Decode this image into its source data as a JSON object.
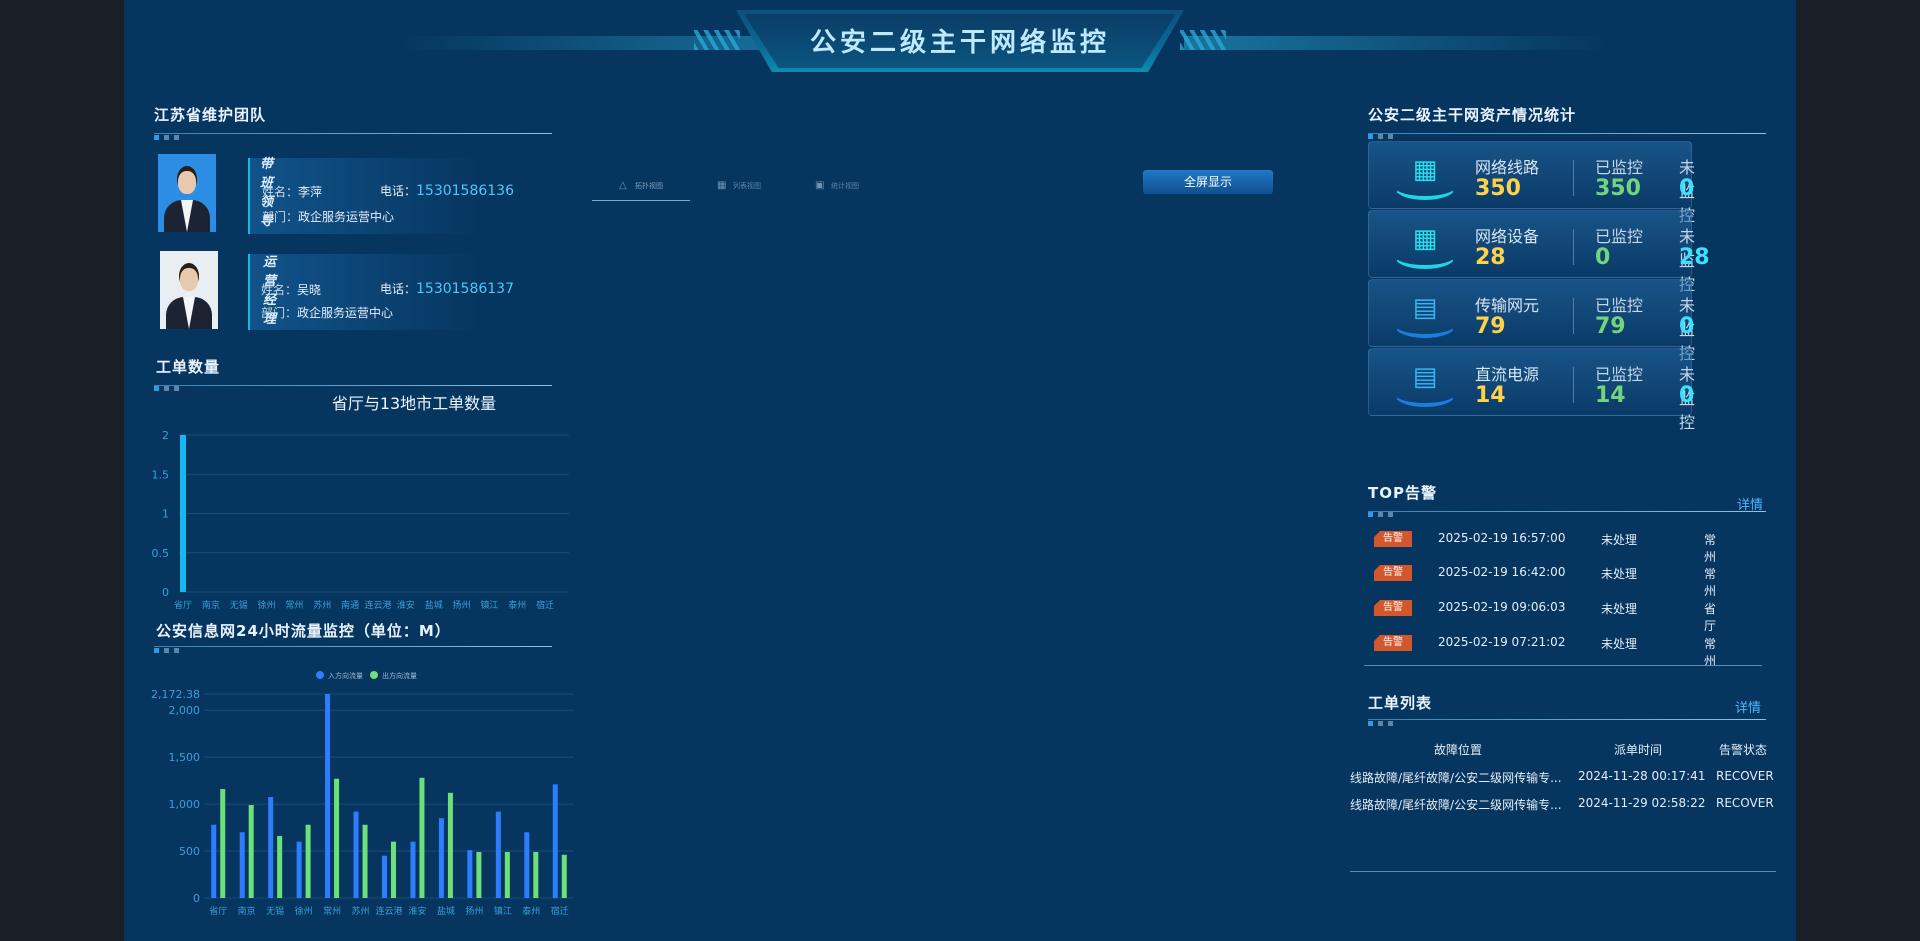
{
  "header": {
    "title": "公安二级主干网络监控"
  },
  "team": {
    "title": "江苏省维护团队",
    "members": [
      {
        "role": "带班领导",
        "name_label": "姓名：",
        "name": "李萍",
        "tel_label": "电话：",
        "tel": "15301586136",
        "dept_label": "部门：",
        "dept": "政企服务运营中心"
      },
      {
        "role": "运营经理",
        "name_label": "姓名：",
        "name": "吴晓",
        "tel_label": "电话：",
        "tel": "15301586137",
        "dept_label": "部门：",
        "dept": "政企服务运营中心"
      }
    ]
  },
  "work_orders_count": {
    "title": "工单数量",
    "chart_title": "省厅与13地市工单数量"
  },
  "traffic": {
    "title": "公安信息网24小时流量监控（单位：M）"
  },
  "center": {
    "tabs": [
      {
        "label": "拓扑视图",
        "icon": "topology-icon"
      },
      {
        "label": "列表视图",
        "icon": "grid-icon"
      },
      {
        "label": "统计视图",
        "icon": "chart-icon"
      }
    ],
    "button_label": "全屏显示"
  },
  "assets": {
    "title": "公安二级主干网资产情况统计",
    "monitored_label": "已监控",
    "unmonitored_label": "未监控",
    "rows": [
      {
        "name": "网络线路",
        "total": "350",
        "monitored": "350",
        "unmonitored": "0",
        "icon": "server-icon"
      },
      {
        "name": "网络设备",
        "total": "28",
        "monitored": "0",
        "unmonitored": "28",
        "icon": "server-icon"
      },
      {
        "name": "传输网元",
        "total": "79",
        "monitored": "79",
        "unmonitored": "0",
        "icon": "rack-icon"
      },
      {
        "name": "直流电源",
        "total": "14",
        "monitored": "14",
        "unmonitored": "0",
        "icon": "rack-icon"
      }
    ]
  },
  "alarms": {
    "title": "TOP告警",
    "detail": "详情",
    "rows": [
      {
        "tag": "告警",
        "time": "2025-02-19 16:57:00",
        "status": "未处理",
        "city": "常州"
      },
      {
        "tag": "告警",
        "time": "2025-02-19 16:42:00",
        "status": "未处理",
        "city": "常州"
      },
      {
        "tag": "告警",
        "time": "2025-02-19 09:06:03",
        "status": "未处理",
        "city": "省厅"
      },
      {
        "tag": "告警",
        "time": "2025-02-19 07:21:02",
        "status": "未处理",
        "city": "常州"
      }
    ]
  },
  "work_list": {
    "title": "工单列表",
    "detail": "详情",
    "columns": [
      "故障位置",
      "派单时间",
      "告警状态"
    ],
    "rows": [
      {
        "location": "线路故障/尾纤故障/公安二级网传输专...",
        "time": "2024-11-28 00:17:41",
        "status": "RECOVER"
      },
      {
        "location": "线路故障/尾纤故障/公安二级网传输专...",
        "time": "2024-11-29 02:58:22",
        "status": "RECOVER"
      }
    ]
  },
  "chart_data": [
    {
      "type": "bar",
      "title": "省厅与13地市工单数量",
      "categories": [
        "省厅",
        "南京",
        "无锡",
        "徐州",
        "常州",
        "苏州",
        "南通",
        "连云港",
        "淮安",
        "盐城",
        "扬州",
        "镇江",
        "泰州",
        "宿迁"
      ],
      "values": [
        2,
        0,
        0,
        0,
        0,
        0,
        0,
        0,
        0,
        0,
        0,
        0,
        0,
        0
      ],
      "ylim": [
        0,
        2
      ],
      "yticks": [
        "0",
        "0.5",
        "1",
        "1.5",
        "2"
      ],
      "colors": {
        "bar": "#17b7f0"
      }
    },
    {
      "type": "bar",
      "categories": [
        "省厅",
        "南京",
        "无锡",
        "徐州",
        "常州",
        "苏州",
        "连云港",
        "淮安",
        "盐城",
        "扬州",
        "镇江",
        "泰州",
        "宿迁"
      ],
      "series": [
        {
          "name": "入方向流量",
          "values": [
            780,
            700,
            1075,
            600,
            2172.38,
            920,
            450,
            600,
            850,
            510,
            920,
            700,
            1210
          ],
          "color": "#2e7dff"
        },
        {
          "name": "出方向流量",
          "values": [
            1160,
            990,
            660,
            780,
            1270,
            780,
            600,
            1280,
            1120,
            490,
            490,
            490,
            460
          ],
          "color": "#6ee07a"
        }
      ],
      "ylim": [
        0,
        2172.38
      ],
      "yticks": [
        "0",
        "500",
        "1,000",
        "1,500",
        "2,000",
        "2,172.38"
      ],
      "legend": "top-center"
    }
  ]
}
